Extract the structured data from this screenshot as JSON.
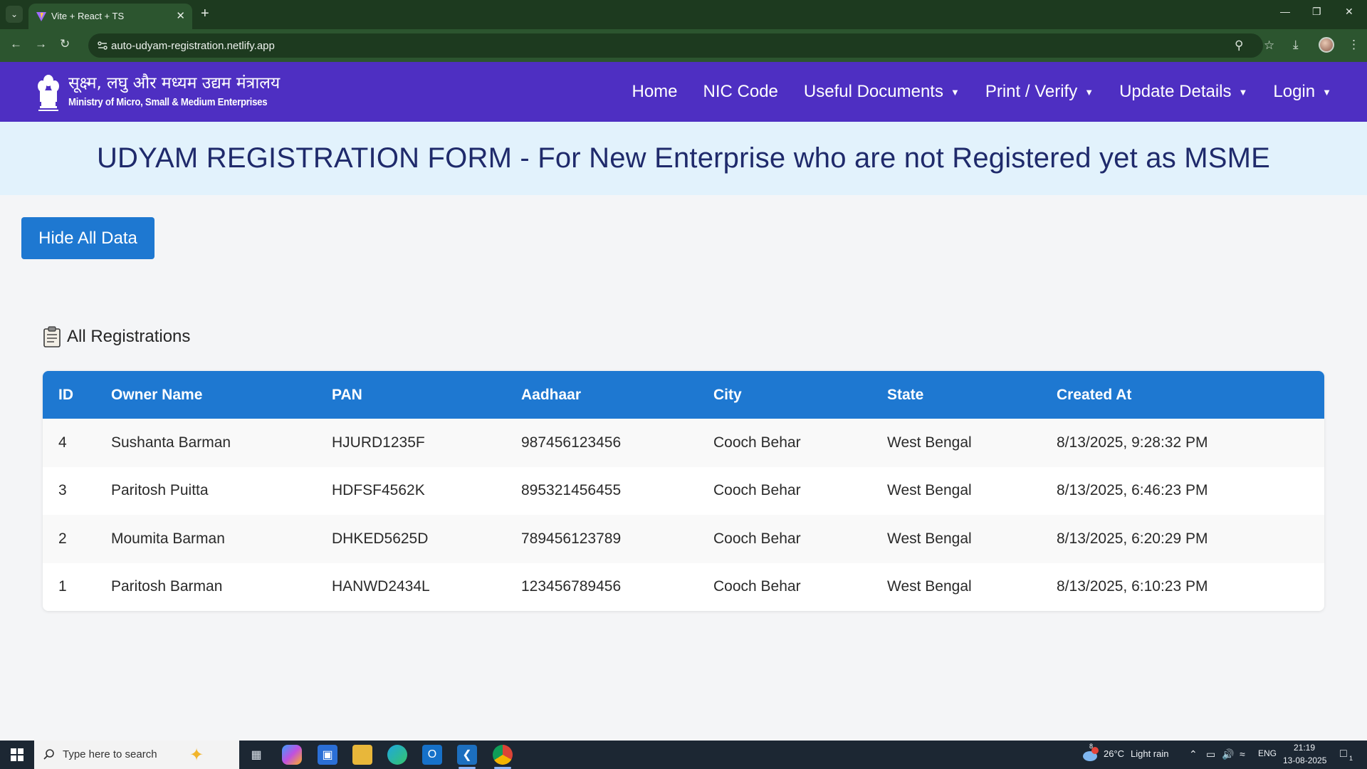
{
  "browser": {
    "tab_title": "Vite + React + TS",
    "url": "auto-udyam-registration.netlify.app"
  },
  "site": {
    "ministry_hindi": "सूक्ष्म, लघु और मध्यम उद्यम मंत्रालय",
    "ministry_english": "Ministry of Micro, Small & Medium Enterprises",
    "nav": [
      {
        "label": "Home",
        "dropdown": false
      },
      {
        "label": "NIC Code",
        "dropdown": false
      },
      {
        "label": "Useful Documents",
        "dropdown": true
      },
      {
        "label": "Print / Verify",
        "dropdown": true
      },
      {
        "label": "Update Details",
        "dropdown": true
      },
      {
        "label": "Login",
        "dropdown": true
      }
    ]
  },
  "banner": {
    "title": "UDYAM REGISTRATION FORM - For New Enterprise who are not Registered yet as MSME"
  },
  "actions": {
    "hide_label": "Hide All Data"
  },
  "registrations": {
    "heading": "All Registrations",
    "columns": [
      "ID",
      "Owner Name",
      "PAN",
      "Aadhaar",
      "City",
      "State",
      "Created At"
    ],
    "rows": [
      [
        "4",
        "Sushanta Barman",
        "HJURD1235F",
        "987456123456",
        "Cooch Behar",
        "West Bengal",
        "8/13/2025, 9:28:32 PM"
      ],
      [
        "3",
        "Paritosh Puitta",
        "HDFSF4562K",
        "895321456455",
        "Cooch Behar",
        "West Bengal",
        "8/13/2025, 6:46:23 PM"
      ],
      [
        "2",
        "Moumita Barman",
        "DHKED5625D",
        "789456123789",
        "Cooch Behar",
        "West Bengal",
        "8/13/2025, 6:20:29 PM"
      ],
      [
        "1",
        "Paritosh Barman",
        "HANWD2434L",
        "123456789456",
        "Cooch Behar",
        "West Bengal",
        "8/13/2025, 6:10:23 PM"
      ]
    ]
  },
  "taskbar": {
    "search_placeholder": "Type here to search",
    "weather_temp": "26°C",
    "weather_desc": "Light rain",
    "weather_badge": "8",
    "language": "ENG",
    "time": "21:19",
    "date": "13-08-2025",
    "notification_count": "1"
  },
  "colors": {
    "tab_bar": "#1d3a1f",
    "toolbar": "#2c552f",
    "header": "#4e2fc2",
    "banner": "#e2f2fc",
    "primary": "#1e78d1",
    "taskbar": "#1c2733"
  }
}
